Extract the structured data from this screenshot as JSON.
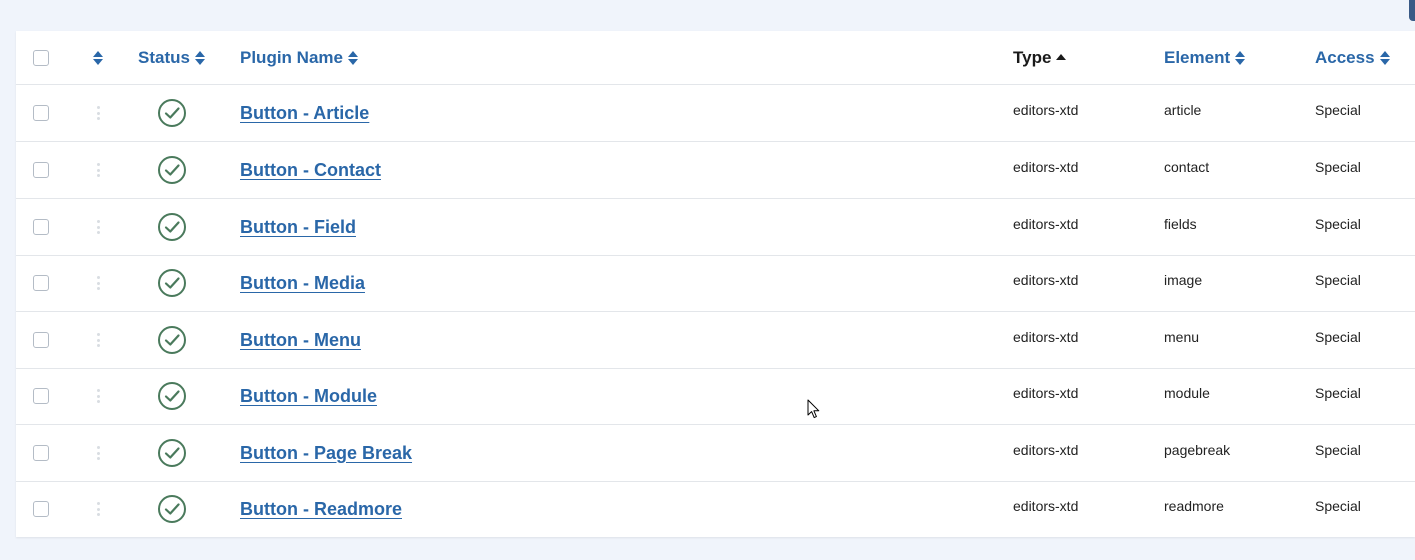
{
  "table": {
    "headers": {
      "status": "Status",
      "plugin_name": "Plugin Name",
      "type": "Type",
      "element": "Element",
      "access": "Access"
    },
    "sort": {
      "column": "type",
      "direction": "ascending"
    },
    "rows": [
      {
        "name": "Button - Article",
        "status": "enabled",
        "type": "editors-xtd",
        "element": "article",
        "access": "Special"
      },
      {
        "name": "Button - Contact",
        "status": "enabled",
        "type": "editors-xtd",
        "element": "contact",
        "access": "Special"
      },
      {
        "name": "Button - Field",
        "status": "enabled",
        "type": "editors-xtd",
        "element": "fields",
        "access": "Special"
      },
      {
        "name": "Button - Media",
        "status": "enabled",
        "type": "editors-xtd",
        "element": "image",
        "access": "Special"
      },
      {
        "name": "Button - Menu",
        "status": "enabled",
        "type": "editors-xtd",
        "element": "menu",
        "access": "Special"
      },
      {
        "name": "Button - Module",
        "status": "enabled",
        "type": "editors-xtd",
        "element": "module",
        "access": "Special"
      },
      {
        "name": "Button - Page Break",
        "status": "enabled",
        "type": "editors-xtd",
        "element": "pagebreak",
        "access": "Special"
      },
      {
        "name": "Button - Readmore",
        "status": "enabled",
        "type": "editors-xtd",
        "element": "readmore",
        "access": "Special"
      }
    ]
  },
  "colors": {
    "link": "#2a67a8",
    "status_enabled": "#4a7a5c",
    "page_bg": "#f0f4fb"
  },
  "icons": {
    "sort_both": "sort-icon",
    "sort_asc": "caret-up-icon",
    "status_enabled": "check-circle-icon",
    "drag": "drag-handle-icon"
  }
}
